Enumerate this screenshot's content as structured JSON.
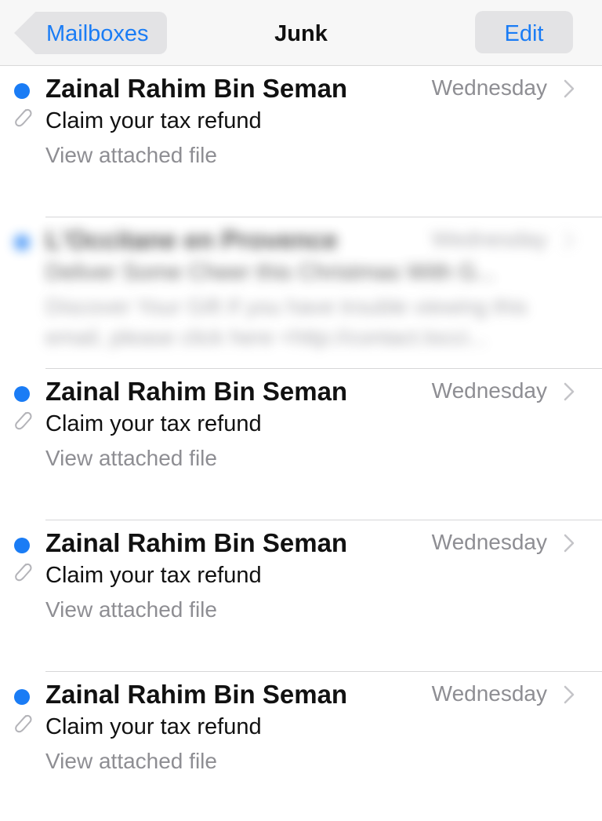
{
  "navbar": {
    "back_label": "Mailboxes",
    "title": "Junk",
    "edit_label": "Edit"
  },
  "colors": {
    "accent": "#1a7cf5",
    "secondary_text": "#8e8e93",
    "navbar_bg": "#f7f7f7",
    "button_bg": "#e3e3e5"
  },
  "messages": [
    {
      "sender": "Zainal Rahim Bin Seman",
      "date": "Wednesday",
      "subject": "Claim your tax refund",
      "preview_line1": "View attached file",
      "preview_line2": "",
      "unread": true,
      "has_attachment": true,
      "blurred": false
    },
    {
      "sender": "L'Occitane en Provence",
      "date": "Wednesday",
      "subject": "Deliver Some Cheer this Christmas With G...",
      "preview_line1": "Discover Your Gift If you have trouble viewing this",
      "preview_line2": "email, please click here <http://contact.locci...",
      "unread": true,
      "has_attachment": false,
      "blurred": true
    },
    {
      "sender": "Zainal Rahim Bin Seman",
      "date": "Wednesday",
      "subject": "Claim your tax refund",
      "preview_line1": "View attached file",
      "preview_line2": "",
      "unread": true,
      "has_attachment": true,
      "blurred": false
    },
    {
      "sender": "Zainal Rahim Bin Seman",
      "date": "Wednesday",
      "subject": "Claim your tax refund",
      "preview_line1": "View attached file",
      "preview_line2": "",
      "unread": true,
      "has_attachment": true,
      "blurred": false
    },
    {
      "sender": "Zainal Rahim Bin Seman",
      "date": "Wednesday",
      "subject": "Claim your tax refund",
      "preview_line1": "View attached file",
      "preview_line2": "",
      "unread": true,
      "has_attachment": true,
      "blurred": false
    }
  ]
}
